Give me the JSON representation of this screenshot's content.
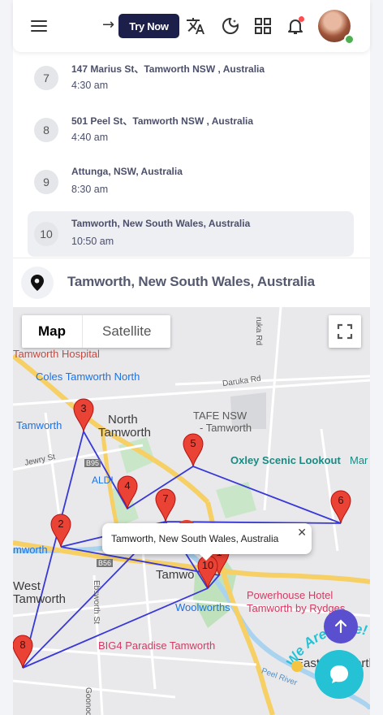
{
  "header": {
    "try_now_label": "Try Now",
    "icons": [
      "menu-icon",
      "login-arrow-icon",
      "translate-icon",
      "dark-mode-icon",
      "apps-grid-icon",
      "bell-icon"
    ]
  },
  "stops": [
    {
      "number": "7",
      "address": "147 Marius St、Tamworth NSW , Australia",
      "time": "4:30 am"
    },
    {
      "number": "8",
      "address": "501 Peel St、Tamworth NSW , Australia",
      "time": "4:40 am"
    },
    {
      "number": "9",
      "address": "Attunga, NSW, Australia",
      "time": "8:30 am"
    },
    {
      "number": "10",
      "address": "Tamworth, New South Wales, Australia",
      "time": "10:50 am"
    }
  ],
  "selected_location": "Tamworth, New South Wales, Australia",
  "map": {
    "type_map": "Map",
    "type_satellite": "Satellite",
    "labels": {
      "hospital": "Tamworth Hospital",
      "coles": "Coles Tamworth North",
      "tamworth_west": "Tamworth",
      "north_tamworth_1": "North",
      "north_tamworth_2": "Tamworth",
      "tafe_1": "TAFE NSW",
      "tafe_2": "- Tamworth",
      "oxley": "Oxley Scenic Lookout",
      "mar": "Mar",
      "aldi": "ALDI",
      "jewry": "Jewry St",
      "daruka": "Daruka Rd",
      "ruka": "ruka Rd",
      "b95": "B95",
      "mworth": "mworth",
      "b56": "B56",
      "west_1": "West",
      "west_2": "Tamworth",
      "tamwo": "Tamwo",
      "ebsworth": "Ebsworth St",
      "woolworths": "Woolworths",
      "powerhouse_1": "Powerhouse Hotel",
      "powerhouse_2": "Tamworth by Rydges",
      "big4": "BIG4 Paradise Tamworth",
      "peel": "Peel River",
      "east": "East Tamworth",
      "goonoo": "Goonoo"
    },
    "markers": [
      "1",
      "2",
      "3",
      "4",
      "5",
      "6",
      "7",
      "8",
      "10"
    ],
    "info_window": "Tamworth, New South Wales, Australia",
    "route_color": "#3838d8",
    "marker_color": "#ea4335"
  },
  "widgets": {
    "we_are_here": "We Are Here!"
  }
}
